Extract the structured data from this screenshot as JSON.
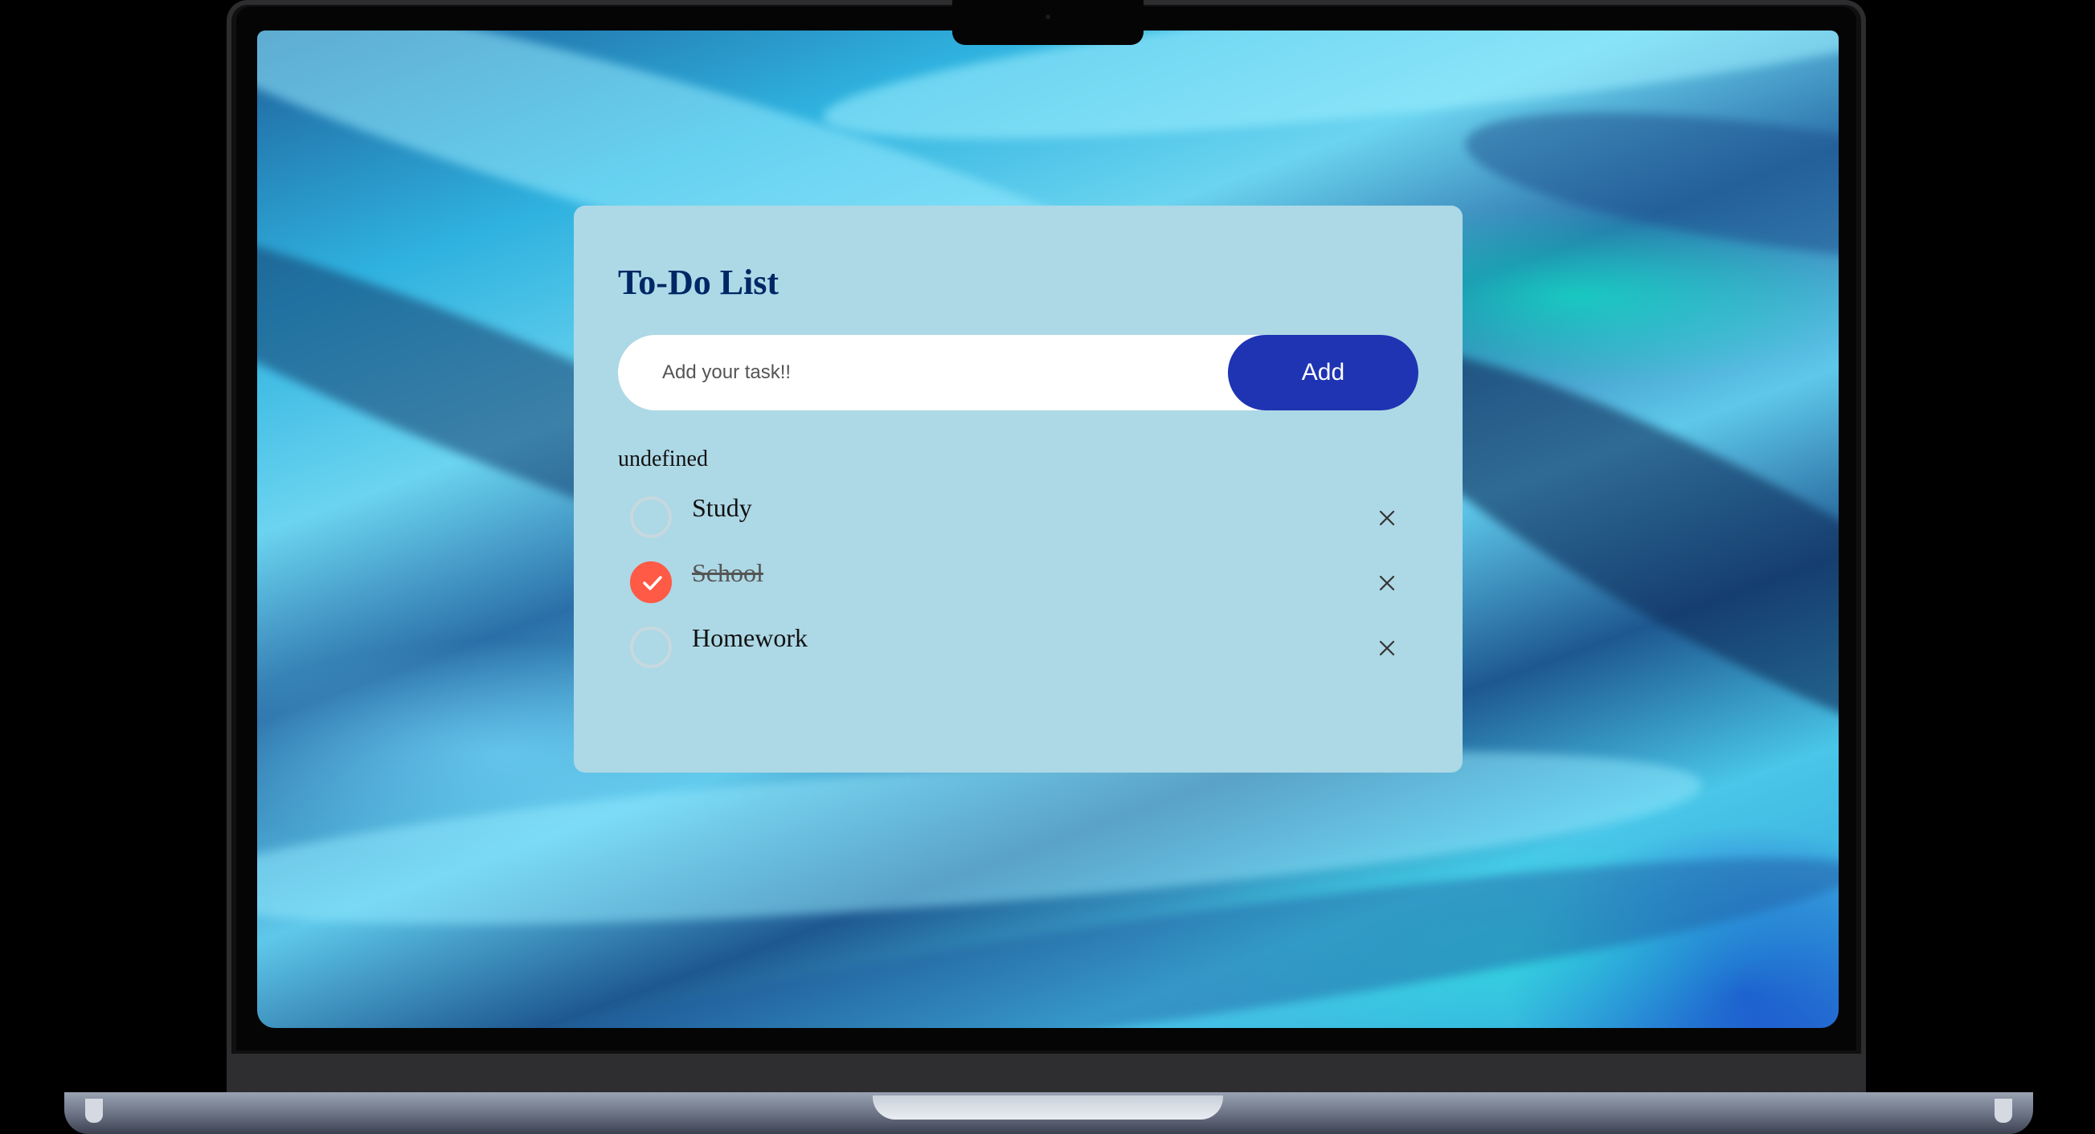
{
  "app": {
    "title": "To-Do List",
    "input": {
      "value": "",
      "placeholder": "Add your task!!"
    },
    "add_button_label": "Add",
    "list_caption": "undefined",
    "tasks": [
      {
        "label": "Study",
        "completed": false
      },
      {
        "label": "School",
        "completed": true
      },
      {
        "label": "Homework",
        "completed": false
      }
    ],
    "delete_icon": "close-icon",
    "check_icon": "checkmark-icon"
  },
  "colors": {
    "card_background": "#add8e6",
    "title": "#002765",
    "add_button": "#1e34b3",
    "checked": "#ff5a45"
  }
}
